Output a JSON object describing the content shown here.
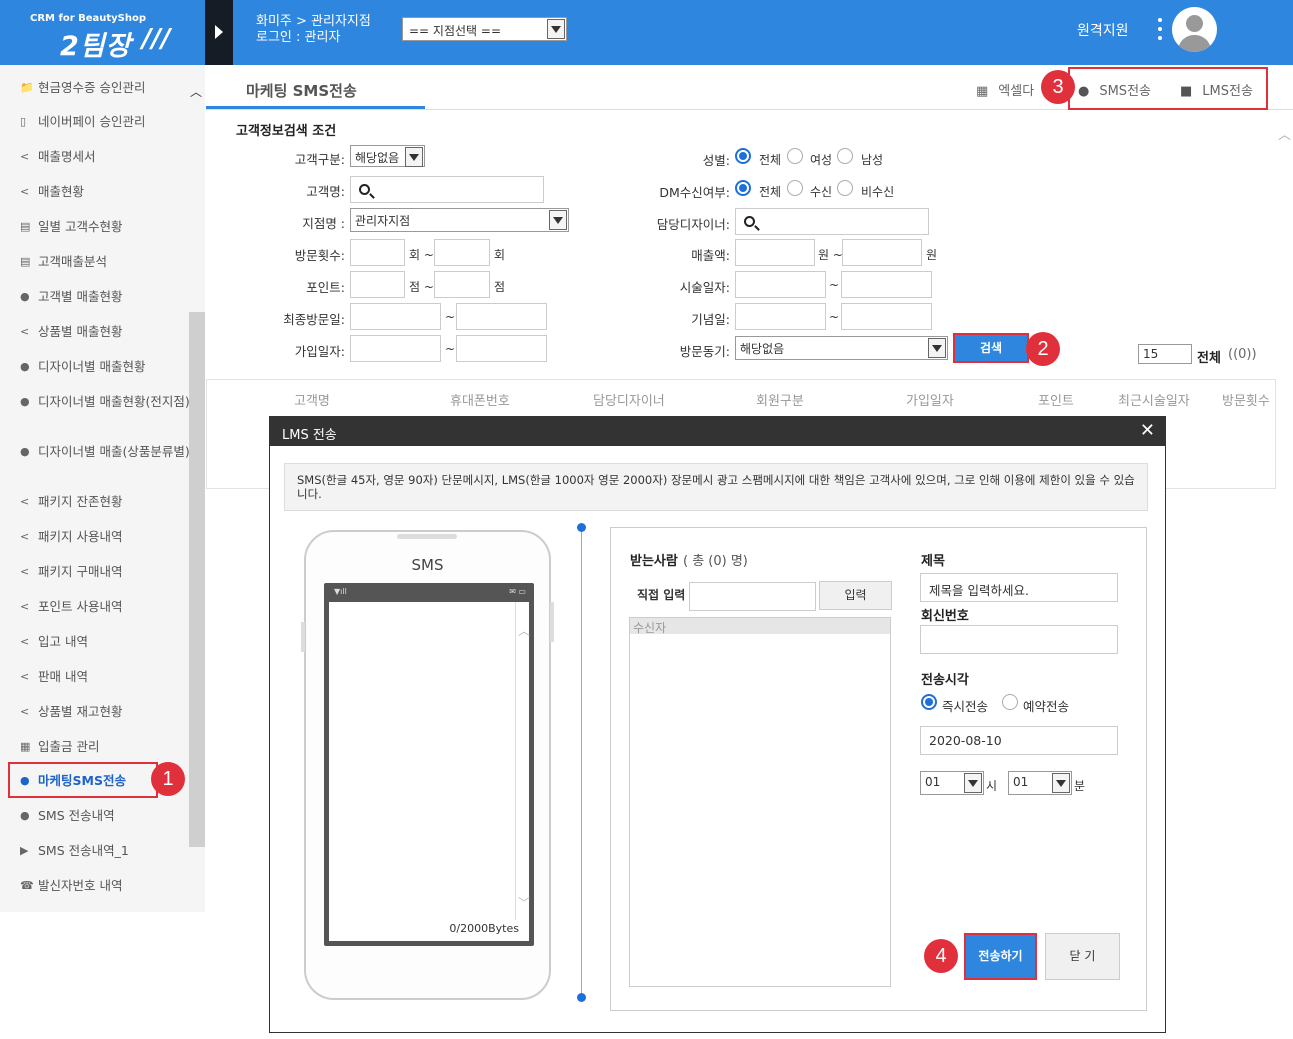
{
  "header": {
    "logo_sub": "CRM for BeautyShop",
    "logo_main": "2팀장",
    "logo_slash": "///",
    "breadcrumb": "화미주 > 관리자지점",
    "login": "로그인 : 관리자",
    "branch_select": "== 지점선택 ==",
    "remote_support": "원격지원"
  },
  "sidebar": {
    "items": [
      {
        "icon": "📁",
        "label": "현금영수증 승인관리"
      },
      {
        "icon": "▯",
        "label": "네이버페이 승인관리"
      },
      {
        "icon": "<",
        "label": "매출명세서"
      },
      {
        "icon": "<",
        "label": "매출현황"
      },
      {
        "icon": "▤",
        "label": "일별 고객수현황"
      },
      {
        "icon": "▤",
        "label": "고객매출분석"
      },
      {
        "icon": "●",
        "label": "고객별 매출현황"
      },
      {
        "icon": "<",
        "label": "상품별 매출현황"
      },
      {
        "icon": "●",
        "label": "디자이너별 매출현황"
      },
      {
        "icon": "●",
        "label": "디자이너별 매출현황(전지점)"
      },
      {
        "icon": "●",
        "label": "디자이너별 매출(상품분류별)"
      },
      {
        "icon": "<",
        "label": "패키지 잔존현황"
      },
      {
        "icon": "<",
        "label": "패키지 사용내역"
      },
      {
        "icon": "<",
        "label": "패키지 구매내역"
      },
      {
        "icon": "<",
        "label": "포인트 사용내역"
      },
      {
        "icon": "<",
        "label": "입고 내역"
      },
      {
        "icon": "<",
        "label": "판매 내역"
      },
      {
        "icon": "<",
        "label": "상품별 재고현황"
      },
      {
        "icon": "▦",
        "label": "입출금 관리"
      },
      {
        "icon": "●",
        "label": "마케팅SMS전송"
      },
      {
        "icon": "●",
        "label": "SMS 전송내역"
      },
      {
        "icon": "▶",
        "label": "SMS 전송내역_1"
      },
      {
        "icon": "☎",
        "label": "발신자번호 내역"
      }
    ]
  },
  "badges": {
    "b1": "1",
    "b2": "2",
    "b3": "3",
    "b4": "4"
  },
  "toolbar": {
    "tab_title": "마케팅 SMS전송",
    "excel": "엑셀다",
    "sms": "SMS전송",
    "lms": "LMS전송"
  },
  "search": {
    "title": "고객정보검색 조건",
    "customer_type_label": "고객구분:",
    "customer_type_value": "해당없음",
    "customer_name_label": "고객명:",
    "branch_label": "지점명 :",
    "branch_value": "관리자지점",
    "visits_label": "방문횟수:",
    "visits_unit": "회 ~",
    "visits_unit2": "회",
    "points_label": "포인트:",
    "points_unit": "점 ~",
    "points_unit2": "점",
    "last_visit_label": "최종방문일:",
    "join_label": "가입일자:",
    "tilde": "~",
    "gender_label": "성별:",
    "gender_all": "전체",
    "gender_f": "여성",
    "gender_m": "남성",
    "dm_label": "DM수신여부:",
    "dm_all": "전체",
    "dm_yes": "수신",
    "dm_no": "비수신",
    "designer_label": "담당디자이너:",
    "sales_label": "매출액:",
    "sales_unit": "원 ~",
    "sales_unit2": "원",
    "service_label": "시술일자:",
    "anniv_label": "기념일:",
    "motive_label": "방문동기:",
    "motive_value": "해당없음",
    "search_button": "검색",
    "page_size": "15",
    "total_label": "전체",
    "total_count": "((0))"
  },
  "table": {
    "columns": [
      "고객명",
      "휴대폰번호",
      "담당디자이너",
      "회원구분",
      "가입일자",
      "포인트",
      "최근시술일자",
      "방문횟수"
    ]
  },
  "modal": {
    "title": "LMS 전송",
    "close": "✕",
    "notice": "SMS(한글 45자, 영문 90자) 단문메시지, LMS(한글 1000자 영문 2000자) 장문메시 광고 스팸메시지에 대한 책임은 고객사에 있으며, 그로 인해 이용에 제한이 있을 수 있습니다.",
    "phone_label": "SMS",
    "bytes": "0/2000Bytes",
    "recipients_title": "받는사람",
    "recipients_count": "( 총 (0) 명)",
    "direct_label": "직접 입력",
    "direct_button": "입력",
    "recipient_header": "수신자",
    "subject_label": "제목",
    "subject_value": "제목을 입력하세요.",
    "reply_label": "회신번호",
    "time_label": "전송시각",
    "immediate": "즉시전송",
    "reserved": "예약전송",
    "date": "2020-08-10",
    "hour": "01",
    "hour_unit": "시",
    "minute": "01",
    "minute_unit": "분",
    "send_button": "전송하기",
    "close_button": "닫 기"
  }
}
